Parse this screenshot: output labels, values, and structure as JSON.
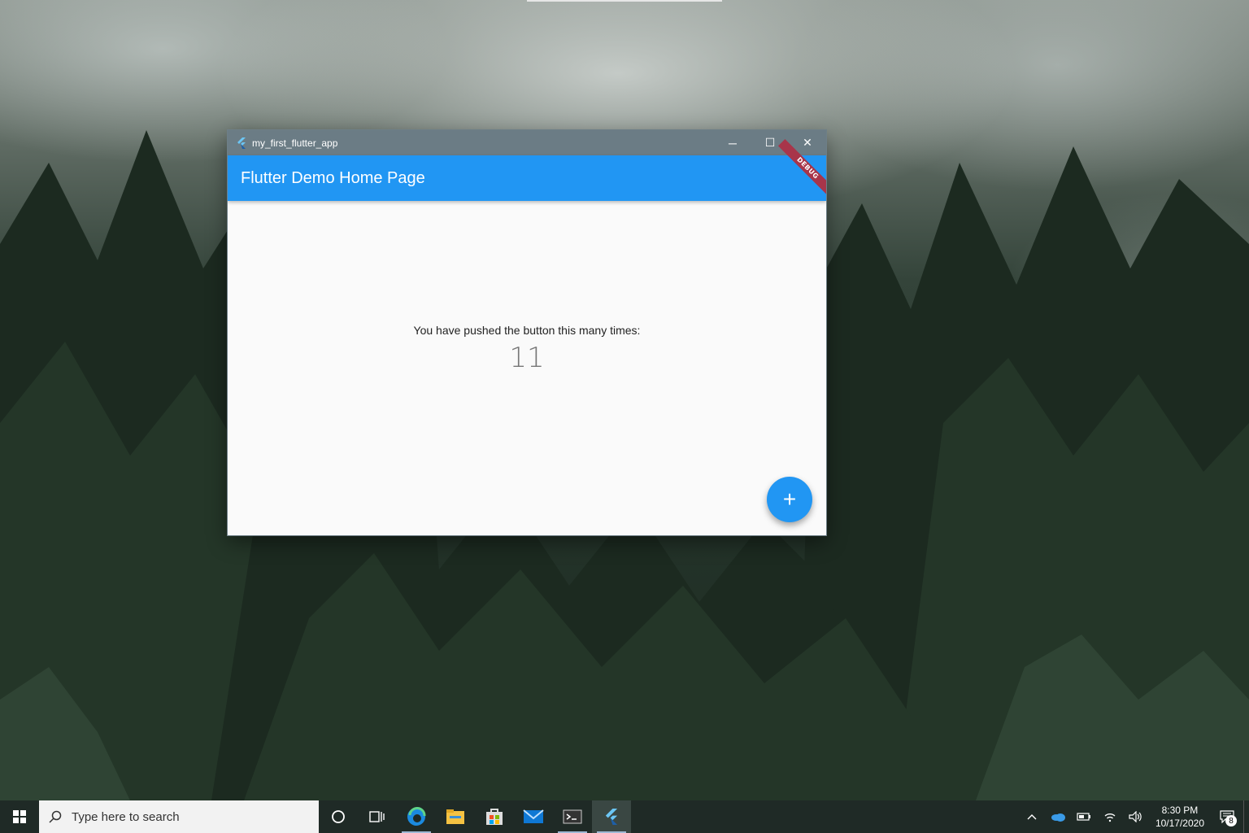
{
  "window": {
    "title": "my_first_flutter_app",
    "minimize_symbol": "─",
    "maximize_symbol": "☐",
    "close_symbol": "✕"
  },
  "appbar": {
    "title": "Flutter Demo Home Page",
    "debug_banner": "DEBUG"
  },
  "content": {
    "message": "You have pushed the button this many times:",
    "counter": "11",
    "fab_symbol": "+"
  },
  "taskbar": {
    "search_placeholder": "Type here to search",
    "icons": [
      "windows-start-icon",
      "cortana-icon",
      "task-view-icon",
      "edge-icon",
      "file-explorer-icon",
      "store-icon",
      "mail-icon",
      "terminal-icon",
      "flutter-app-icon"
    ],
    "clock_time": "8:30 PM",
    "clock_date": "10/17/2020",
    "notification_count": "8"
  },
  "colors": {
    "primary": "#2196f3",
    "titlebar": "#6b7c85",
    "debug": "#a8354a"
  }
}
